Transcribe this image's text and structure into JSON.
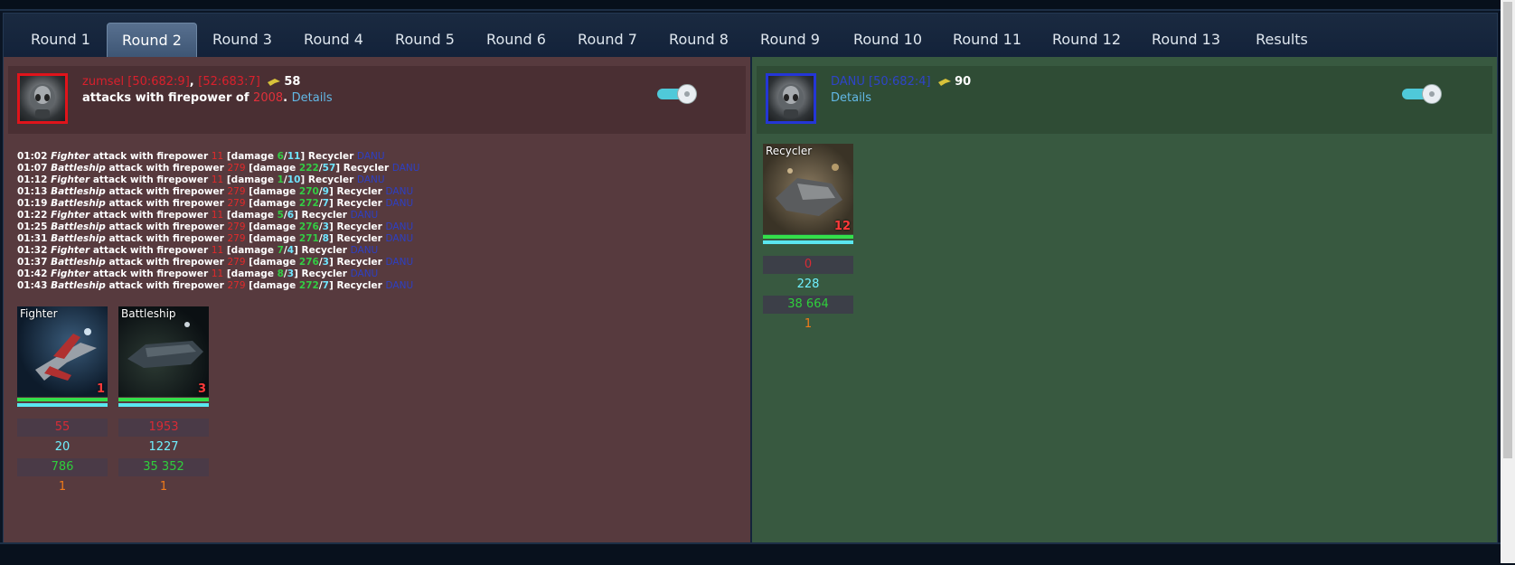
{
  "tabs": [
    "Round 1",
    "Round 2",
    "Round 3",
    "Round 4",
    "Round 5",
    "Round 6",
    "Round 7",
    "Round 8",
    "Round 9",
    "Round 10",
    "Round 11",
    "Round 12",
    "Round 13",
    "Results"
  ],
  "active_tab": "Round 2",
  "attacker": {
    "name": "zumsel [50:682:9]",
    "sep": ",",
    "name2": "[52:683:7]",
    "ships": "58",
    "attack_text": "attacks with firepower of",
    "firepower": "2008",
    "dot": ".",
    "details": "Details",
    "log": [
      {
        "time": "01:02",
        "ship": "Fighter",
        "text": "attack with firepower",
        "fp": "11",
        "dmg_open": "[damage",
        "dmg": "6",
        "cnt": "11",
        "target_text": "Recycler",
        "target": "DANU"
      },
      {
        "time": "01:07",
        "ship": "Battleship",
        "text": "attack with firepower",
        "fp": "279",
        "dmg_open": "[damage",
        "dmg": "222",
        "cnt": "57",
        "target_text": "Recycler",
        "target": "DANU"
      },
      {
        "time": "01:12",
        "ship": "Fighter",
        "text": "attack with firepower",
        "fp": "11",
        "dmg_open": "[damage",
        "dmg": "1",
        "cnt": "10",
        "target_text": "Recycler",
        "target": "DANU"
      },
      {
        "time": "01:13",
        "ship": "Battleship",
        "text": "attack with firepower",
        "fp": "279",
        "dmg_open": "[damage",
        "dmg": "270",
        "cnt": "9",
        "target_text": "Recycler",
        "target": "DANU"
      },
      {
        "time": "01:19",
        "ship": "Battleship",
        "text": "attack with firepower",
        "fp": "279",
        "dmg_open": "[damage",
        "dmg": "272",
        "cnt": "7",
        "target_text": "Recycler",
        "target": "DANU"
      },
      {
        "time": "01:22",
        "ship": "Fighter",
        "text": "attack with firepower",
        "fp": "11",
        "dmg_open": "[damage",
        "dmg": "5",
        "cnt": "6",
        "target_text": "Recycler",
        "target": "DANU"
      },
      {
        "time": "01:25",
        "ship": "Battleship",
        "text": "attack with firepower",
        "fp": "279",
        "dmg_open": "[damage",
        "dmg": "276",
        "cnt": "3",
        "target_text": "Recycler",
        "target": "DANU"
      },
      {
        "time": "01:31",
        "ship": "Battleship",
        "text": "attack with firepower",
        "fp": "279",
        "dmg_open": "[damage",
        "dmg": "271",
        "cnt": "8",
        "target_text": "Recycler",
        "target": "DANU"
      },
      {
        "time": "01:32",
        "ship": "Fighter",
        "text": "attack with firepower",
        "fp": "11",
        "dmg_open": "[damage",
        "dmg": "7",
        "cnt": "4",
        "target_text": "Recycler",
        "target": "DANU"
      },
      {
        "time": "01:37",
        "ship": "Battleship",
        "text": "attack with firepower",
        "fp": "279",
        "dmg_open": "[damage",
        "dmg": "276",
        "cnt": "3",
        "target_text": "Recycler",
        "target": "DANU"
      },
      {
        "time": "01:42",
        "ship": "Fighter",
        "text": "attack with firepower",
        "fp": "11",
        "dmg_open": "[damage",
        "dmg": "8",
        "cnt": "3",
        "target_text": "Recycler",
        "target": "DANU"
      },
      {
        "time": "01:43",
        "ship": "Battleship",
        "text": "attack with firepower",
        "fp": "279",
        "dmg_open": "[damage",
        "dmg": "272",
        "cnt": "7",
        "target_text": "Recycler",
        "target": "DANU"
      }
    ],
    "cards": [
      {
        "label": "Fighter",
        "count": "1",
        "s1": "55",
        "s2": "20",
        "s3": "786",
        "s4": "1"
      },
      {
        "label": "Battleship",
        "count": "3",
        "s1": "1953",
        "s2": "1227",
        "s3": "35 352",
        "s4": "1"
      }
    ]
  },
  "defender": {
    "name": "DANU [50:682:4]",
    "ships": "90",
    "details": "Details",
    "cards": [
      {
        "label": "Recycler",
        "count": "12",
        "s1": "0",
        "s2": "228",
        "s3": "38 664",
        "s4": "1"
      }
    ]
  },
  "colors": {
    "attacker_bg": "#573a3e",
    "defender_bg": "#385940",
    "accent": "#62b8e6",
    "toggle": "#4fc9d9"
  }
}
